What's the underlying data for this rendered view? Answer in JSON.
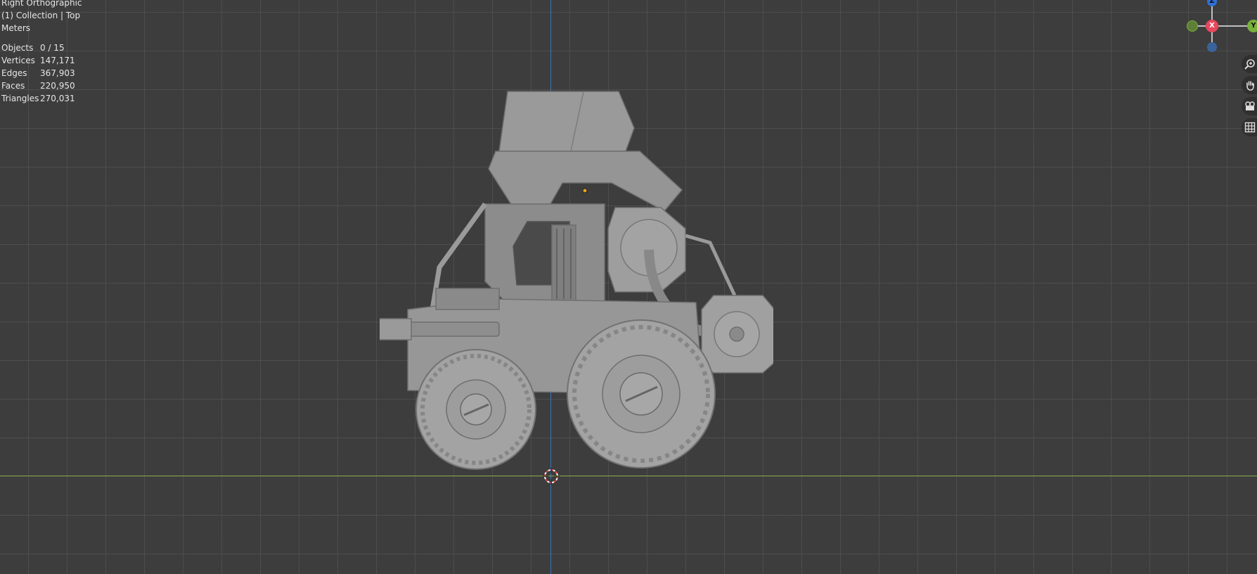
{
  "viewport": {
    "view_name": "Right Orthographic",
    "collection_info": "(1) Collection | Top",
    "units": "Meters",
    "stats": [
      {
        "label": "Objects",
        "value": "0 / 15"
      },
      {
        "label": "Vertices",
        "value": "147,171"
      },
      {
        "label": "Edges",
        "value": "367,903"
      },
      {
        "label": "Faces",
        "value": "220,950"
      },
      {
        "label": "Triangles",
        "value": "270,031"
      }
    ]
  },
  "gizmo": {
    "z_label": "Z",
    "x_label": "X",
    "y_label": "Y",
    "z_color": "#2f6fd6",
    "x_color": "#e8475c",
    "y_color": "#78b13b"
  },
  "navigation_tools": [
    "zoom-icon",
    "hand-pan-icon",
    "camera-icon",
    "grid-icon"
  ],
  "colors": {
    "background": "#3d3d3d",
    "grid": "#5a5a5a",
    "axis_y": "#3b73b8",
    "axis_x": "#7aa33a",
    "model": "#9a9a9a"
  }
}
